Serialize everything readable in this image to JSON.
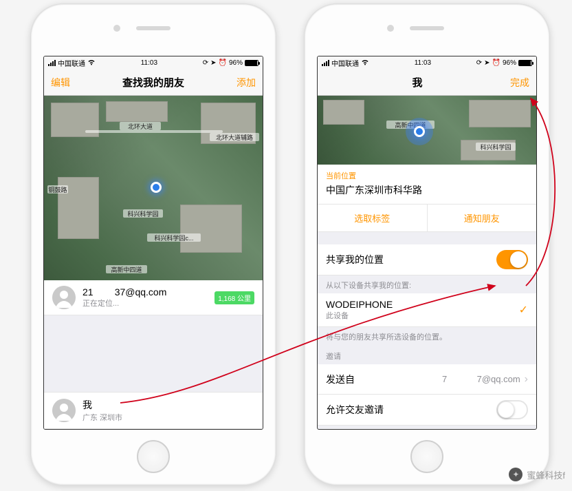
{
  "status": {
    "carrier": "中国联通",
    "time": "11:03",
    "battery": "96%"
  },
  "left": {
    "nav_left": "编辑",
    "nav_title": "查找我的朋友",
    "nav_right": "添加",
    "friend_name": "21        37@qq.com",
    "friend_sub": "正在定位...",
    "friend_badge": "1,168 公里",
    "me_label": "我",
    "me_sub": "广东 深圳市",
    "map_labels": {
      "road1": "北环大道",
      "road2": "北环大道辅路",
      "poi1": "科兴科学园",
      "poi2": "科兴科学园c...",
      "road3": "铜鼓路",
      "road4": "高新中四道"
    }
  },
  "right": {
    "nav_title": "我",
    "nav_right": "完成",
    "loc_label": "当前位置",
    "loc_addr": "中国广东深圳市科华路",
    "action_left": "选取标签",
    "action_right": "通知朋友",
    "share_label": "共享我的位置",
    "devices_header": "从以下设备共享我的位置:",
    "device_name": "WODEIPHONE",
    "device_sub": "此设备",
    "devices_footer": "将与您的朋友共享所选设备的位置。",
    "invite_header": "邀请",
    "send_from": "发送自",
    "send_from_val": "7            7@qq.com",
    "allow_label": "允许交友邀请",
    "map_labels": {
      "road": "高新中四道",
      "poi": "科兴科学园"
    }
  },
  "watermark": "蜜蜂科技f"
}
